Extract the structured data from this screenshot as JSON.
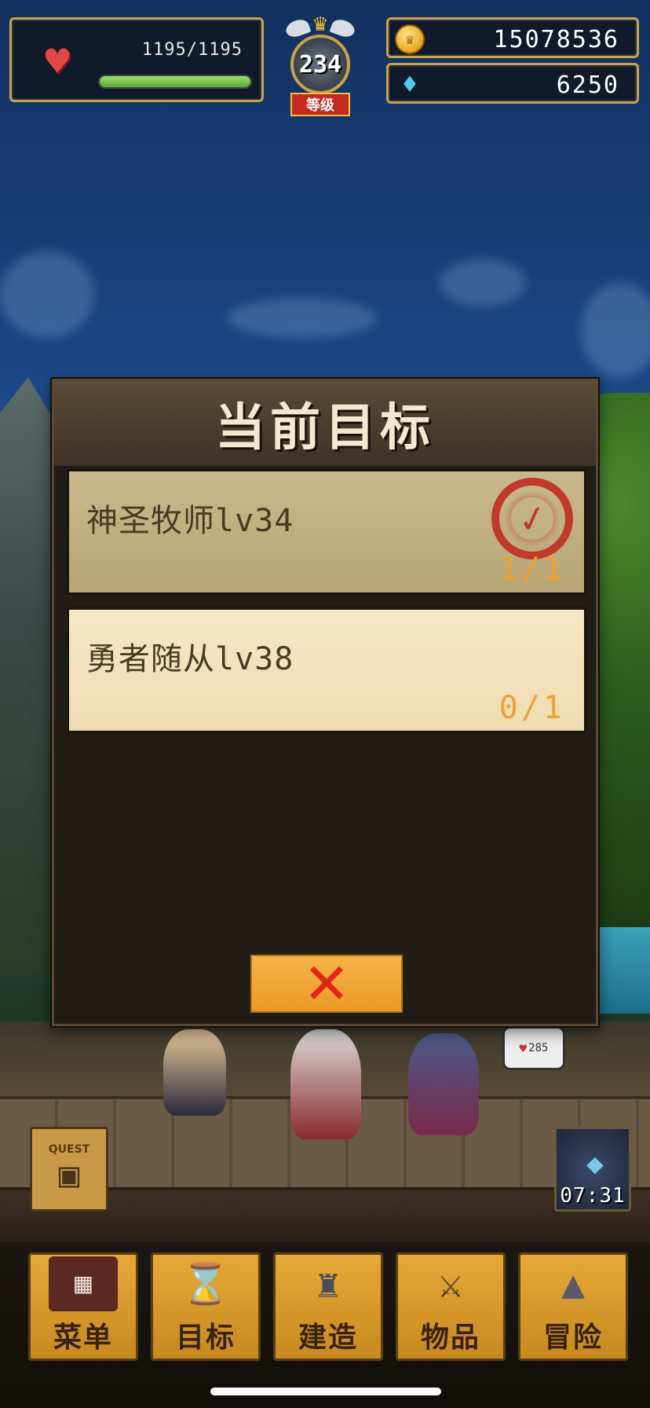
{
  "hud": {
    "hp_text": "1195/1195",
    "hp_fraction": 1.0,
    "level": "234",
    "level_label": "等级",
    "gold": "15078536",
    "gems": "6250"
  },
  "modal": {
    "title": "当前目标",
    "quests": [
      {
        "name": "神圣牧师lv34",
        "progress": "1/1",
        "completed": true
      },
      {
        "name": "勇者随从lv38",
        "progress": "0/1",
        "completed": false
      }
    ],
    "close_icon": "close-x-icon"
  },
  "field": {
    "quest_chest_label": "QUEST",
    "timer": "07:31",
    "enemy_hp": "285"
  },
  "nav": {
    "items": [
      {
        "label": "菜单",
        "icon": "grid-menu-icon"
      },
      {
        "label": "目标",
        "icon": "quest-scroll-icon"
      },
      {
        "label": "建造",
        "icon": "castle-icon"
      },
      {
        "label": "物品",
        "icon": "items-bag-icon"
      },
      {
        "label": "冒险",
        "icon": "mountain-icon"
      }
    ]
  },
  "colors": {
    "gold": "#f0a030",
    "hp_green": "#58a83a",
    "close_red": "#e02818",
    "button_orange": "#ea9a28"
  }
}
